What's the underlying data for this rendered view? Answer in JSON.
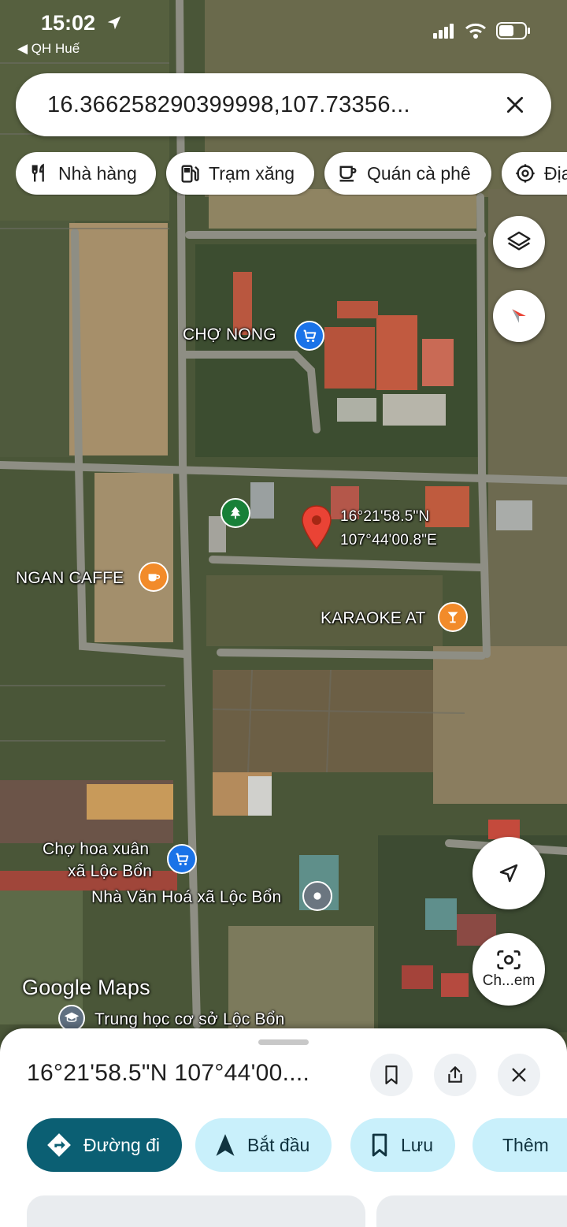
{
  "status_bar": {
    "time": "15:02",
    "back_app": "◀ QH Huế"
  },
  "search": {
    "query": "16.366258290399998,107.73356..."
  },
  "chips": [
    {
      "label": "Nhà hàng",
      "icon": "restaurant-icon"
    },
    {
      "label": "Trạm xăng",
      "icon": "gas-station-icon"
    },
    {
      "label": "Quán cà phê",
      "icon": "coffee-icon"
    },
    {
      "label": "Địa",
      "icon": "attraction-icon"
    }
  ],
  "map": {
    "dropped_pin": {
      "lat_label": "16°21'58.5\"N",
      "lng_label": "107°44'00.8\"E"
    },
    "pois": [
      {
        "label": "CHỢ NONG",
        "icon": "shopping-cart-icon",
        "color": "#1a73e8"
      },
      {
        "label": "NGAN CAFFE",
        "icon": "coffee-icon",
        "color": "#f28b2a"
      },
      {
        "label": "KARAOKE AT",
        "icon": "cocktail-icon",
        "color": "#f28b2a"
      },
      {
        "label": "Chợ hoa xuân\nxã Lộc Bổn",
        "line1": "Chợ hoa xuân",
        "line2": "xã Lộc Bổn",
        "icon": "shopping-cart-icon",
        "color": "#1a73e8"
      },
      {
        "label": "Nhà Văn Hoá xã Lộc Bổn",
        "icon": "place-dot-icon",
        "color": "#6b7680"
      },
      {
        "label": "Trung học cơ sở Lộc Bổn",
        "icon": "school-icon",
        "color": "#5f6f80"
      },
      {
        "label": "",
        "icon": "tree-icon",
        "color": "#188038"
      }
    ],
    "watermark": "Google Maps"
  },
  "controls": {
    "lens_label": "Ch...em"
  },
  "sheet": {
    "title": "16°21'58.5\"N 107°44'00....",
    "actions": [
      {
        "label": "Đường đi",
        "icon": "directions-icon"
      },
      {
        "label": "Bắt đầu",
        "icon": "navigation-arrow-icon"
      },
      {
        "label": "Lưu",
        "icon": "bookmark-icon"
      },
      {
        "label": "Thêm",
        "icon": "flag-icon"
      }
    ]
  },
  "colors": {
    "primary": "#0b5f73",
    "secondary": "#c9f0fb",
    "pin_red": "#ea4335",
    "poi_blue": "#1a73e8",
    "poi_orange": "#f28b2a"
  }
}
